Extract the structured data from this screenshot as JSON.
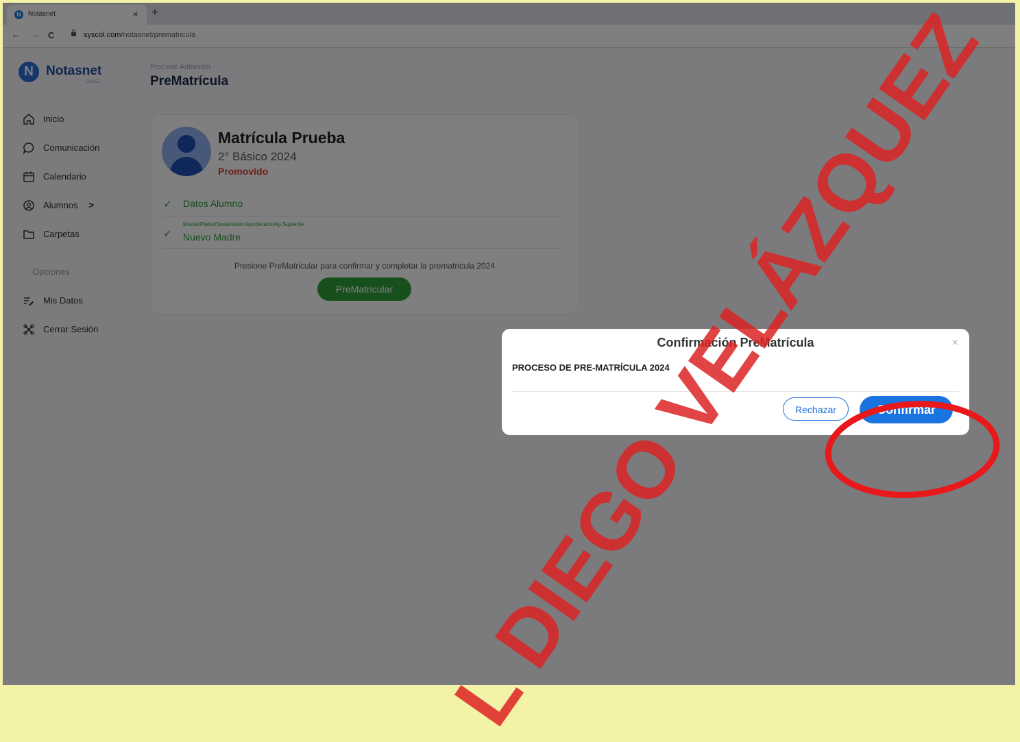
{
  "browser": {
    "tab_title": "Notasnet",
    "favicon_letter": "N",
    "tab_close": "×",
    "new_tab": "+",
    "url_host": "syscol.com",
    "url_path": "/notasnet/prematricula",
    "back": "←",
    "forward": "→",
    "reload": "C"
  },
  "app": {
    "logo": {
      "letter": "N",
      "name": "Notasnet",
      "sub": "CHILE"
    },
    "menu": [
      {
        "label": "Inicio",
        "icon": "home-icon"
      },
      {
        "label": "Comunicación",
        "icon": "chat-icon"
      },
      {
        "label": "Calendario",
        "icon": "calendar-icon"
      },
      {
        "label": "Alumnos",
        "icon": "user-circle-icon",
        "chevron": ">"
      },
      {
        "label": "Carpetas",
        "icon": "folder-icon"
      }
    ],
    "options_header": "Opciones",
    "options": [
      {
        "label": "Mis Datos",
        "icon": "edit-list-icon"
      },
      {
        "label": "Cerrar Sesión",
        "icon": "logout-icon"
      }
    ],
    "breadcrumb": "Proceso Admisión",
    "page_title": "PreMatrícula",
    "student": {
      "name": "Matrícula Prueba",
      "grade": "2° Básico 2024",
      "status": "Promovido"
    },
    "rows": [
      {
        "check": "✓",
        "label": "Datos Alumno"
      },
      {
        "check": "✓",
        "small": "Madre/Padre/Sostenedor/Apoderado/Ap.Suplente",
        "label": "Nuevo Madre"
      }
    ],
    "prompt": "Presione PreMatricular para confirmar y completar la prematricula 2024",
    "prematricular_button": "PreMatricular"
  },
  "modal": {
    "title": "Confirmación PreMatrícula",
    "close": "×",
    "body": "PROCESO DE PRE-MATRÍCULA 2024",
    "reject_button": "Rechazar",
    "confirm_button": "Confirmar"
  },
  "colors": {
    "accent": "#1a74e0",
    "success": "#2f9e3a",
    "warning": "#e03b2f",
    "annotation": "#e8181b"
  },
  "watermark": "L DIEGO VELÁZQUEZ"
}
